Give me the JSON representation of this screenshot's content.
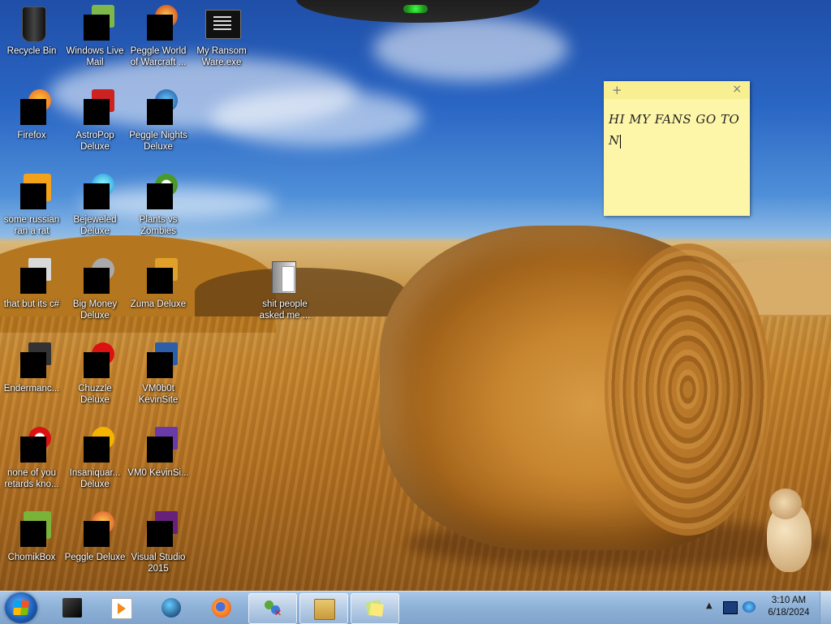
{
  "desktop": {
    "icons": [
      {
        "label": "Recycle Bin",
        "name": "recycle-bin"
      },
      {
        "label": "Windows Live Mail",
        "name": "windows-live-mail"
      },
      {
        "label": "Peggle World of Warcraft ...",
        "name": "peggle-world-of-warcraft"
      },
      {
        "label": "My Ransom Ware.exe",
        "name": "my-ransom-ware"
      },
      {
        "label": "Firefox",
        "name": "firefox"
      },
      {
        "label": "AstroPop Deluxe",
        "name": "astropop-deluxe"
      },
      {
        "label": "Peggle Nights Deluxe",
        "name": "peggle-nights-deluxe"
      },
      {
        "label": "some russian ran a rat",
        "name": "some-russian-ran-a-rat"
      },
      {
        "label": "Bejeweled Deluxe",
        "name": "bejeweled-deluxe"
      },
      {
        "label": "Plants vs Zombies",
        "name": "plants-vs-zombies"
      },
      {
        "label": "that but its c#",
        "name": "that-but-its-csharp"
      },
      {
        "label": "Big Money Deluxe",
        "name": "big-money-deluxe"
      },
      {
        "label": "Zuma Deluxe",
        "name": "zuma-deluxe"
      },
      {
        "label": "shit people asked me ...",
        "name": "shit-people-asked-me"
      },
      {
        "label": "Endermanc...",
        "name": "endermanc"
      },
      {
        "label": "Chuzzle Deluxe",
        "name": "chuzzle-deluxe"
      },
      {
        "label": "VM0b0t KevinSite",
        "name": "vm0b0t-kevinsite"
      },
      {
        "label": "none of you retards kno...",
        "name": "none-of-you"
      },
      {
        "label": "Insaniquar... Deluxe",
        "name": "insaniquarium-deluxe"
      },
      {
        "label": "VM0 KevinSi...",
        "name": "vm0-kevinsite"
      },
      {
        "label": "ChomikBox",
        "name": "chomikbox"
      },
      {
        "label": "Peggle Deluxe",
        "name": "peggle-deluxe"
      },
      {
        "label": "Visual Studio 2015",
        "name": "visual-studio-2015"
      }
    ]
  },
  "sticky_note": {
    "line1": "HI MY FANS GO TO",
    "line2": "N",
    "add_glyph": "+",
    "close_glyph": "×"
  },
  "taskbar": {
    "items": [
      {
        "icon": "media-center-icon"
      },
      {
        "icon": "media-player-icon"
      },
      {
        "icon": "globe-icon"
      },
      {
        "icon": "firefox-icon"
      },
      {
        "icon": "messenger-icon",
        "active": true
      },
      {
        "icon": "explorer-window-icon",
        "active": true
      },
      {
        "icon": "sticky-notes-icon",
        "active": true
      }
    ],
    "clock_time": "3:10 AM",
    "clock_date": "6/18/2024",
    "tray_up": "▲"
  },
  "colors": {
    "sky": "#2a66c4",
    "field": "#c6862f",
    "note": "#fdf6a8",
    "taskbar": "#8fb2d8"
  }
}
